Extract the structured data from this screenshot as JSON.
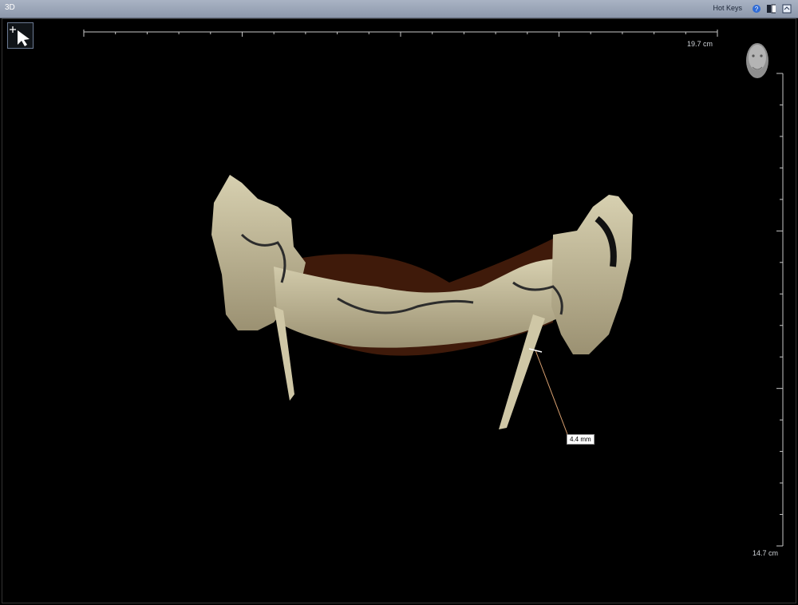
{
  "window": {
    "title": "3D",
    "hotkeys_label": "Hot Keys"
  },
  "toolbar_icons": [
    "help-icon",
    "layout-icon",
    "export-icon"
  ],
  "tool": {
    "icon": "pointer-crosshair-icon"
  },
  "scale": {
    "horizontal_label": "19.7 cm",
    "vertical_label": "14.7 cm"
  },
  "orientation": {
    "icon": "head-orientation-icon"
  },
  "measurement": {
    "label": "4.4 mm"
  },
  "colors": {
    "bone": "#c8c0a0",
    "tissue": "#5a2a14",
    "titlebar": "#9aa4b6",
    "measure_line": "#d9a070"
  }
}
